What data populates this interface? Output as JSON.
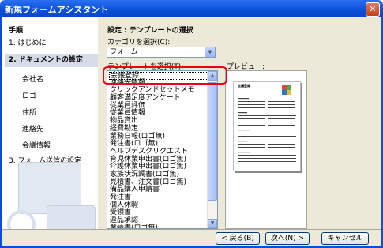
{
  "window": {
    "title": "新規フォームアシスタント",
    "close_glyph": "✕"
  },
  "left": {
    "heading": "手順",
    "steps": [
      {
        "label": "1. はじめに"
      },
      {
        "label": "2. ドキュメントの設定"
      },
      {
        "label": "会社名"
      },
      {
        "label": "ロゴ"
      },
      {
        "label": "住所"
      },
      {
        "label": "連絡先"
      },
      {
        "label": "会議情報"
      },
      {
        "label": "3. フォーム送信の設定"
      }
    ]
  },
  "right": {
    "heading": "設定 : テンプレートの選択",
    "category_label": "カテゴリを選択(C):",
    "category_value": "フォーム",
    "template_label": "テンプレートを選択(T):",
    "preview_label": "プレビュー:",
    "templates": [
      "会議登録",
      "連絡先情報",
      "クリックアンドセットメモ",
      "顧客満足度アンケート",
      "従業員評価",
      "従業員情報",
      "物品貸出",
      "経費勘定",
      "業務日報(ロゴ無)",
      "発注書(ロゴ無)",
      "ヘルプデスクリクエスト",
      "育児休業申出書(ロゴ無)",
      "介護休業申出書(ロゴ無)",
      "家族状況調書(ロゴ無)",
      "見積書、注文書(ロゴ無)",
      "備品購入申請書",
      "発注書",
      "個人休暇",
      "受領書",
      "返品承認",
      "業績書(ロゴ無)",
      "請求明細書(ロゴ無)"
    ],
    "selected_index": 0,
    "preview_doc_title": "会議登録"
  },
  "colors": {
    "highlight": "#e8001c",
    "titlebar": "#0a4fd8"
  },
  "buttons": {
    "back": "< 戻る(B)",
    "next": "次へ(N) >",
    "cancel": "キャンセル"
  }
}
